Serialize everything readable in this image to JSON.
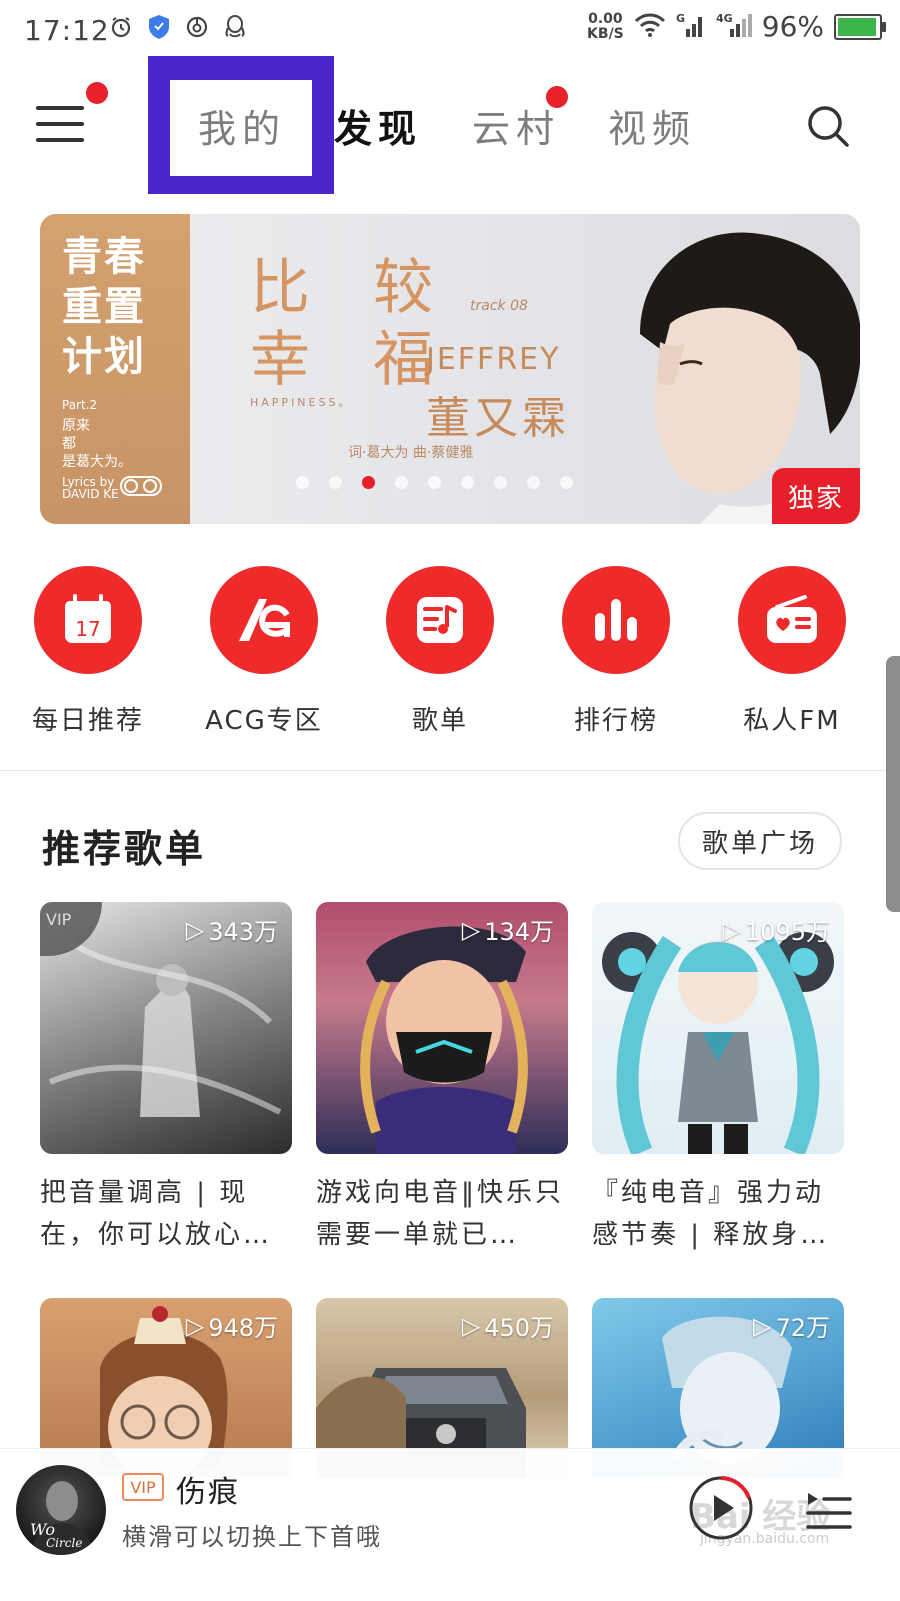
{
  "status_bar": {
    "time": "17:12",
    "net_speed_value": "0.00",
    "net_speed_unit": "KB/S",
    "battery": "96%",
    "battery_level": 0.96,
    "icons": [
      "alarm-icon",
      "shield-icon",
      "netease-icon",
      "qq-icon",
      "wifi-icon",
      "signal-g-icon",
      "signal-4g-icon"
    ]
  },
  "nav": {
    "tabs": [
      {
        "label": "我的",
        "active": false
      },
      {
        "label": "发现",
        "active": true
      },
      {
        "label": "云村",
        "active": false
      },
      {
        "label": "视频",
        "active": false
      }
    ],
    "highlight_color": "#4a25c9"
  },
  "banner": {
    "left_title": "青春重置计划",
    "left_part": "Part.2",
    "left_lines": [
      "原来",
      "都",
      "是葛大为。"
    ],
    "left_credit": "Lyrics by DAVID KE",
    "song_title_1": "比 较",
    "song_title_2": "幸 福",
    "track": "track 08",
    "happiness": "HAPPINESS。",
    "artist_en": "JEFFREY",
    "artist_cn": "董又霖",
    "credits": "词·葛大为   曲·蔡健雅",
    "badge": "独家",
    "dots_total": 9,
    "dots_active_index": 2
  },
  "quick_entries": [
    {
      "label": "每日推荐",
      "icon": "calendar-icon",
      "day": "17"
    },
    {
      "label": "ACG专区",
      "icon": "acg-icon"
    },
    {
      "label": "歌单",
      "icon": "playlist-icon"
    },
    {
      "label": "排行榜",
      "icon": "chart-icon"
    },
    {
      "label": "私人FM",
      "icon": "radio-icon"
    }
  ],
  "section": {
    "title": "推荐歌单",
    "button": "歌单广场"
  },
  "playlists": [
    {
      "title": "把音量调高 | 现在，你可以放心…",
      "plays": "343万",
      "vip": "VIP",
      "colors": [
        "#cfcfcf",
        "#3a3a3a"
      ]
    },
    {
      "title": "游戏向电音‖快乐只需要一单就已…",
      "plays": "134万",
      "colors": [
        "#c06a8a",
        "#2c2b4e"
      ]
    },
    {
      "title": "『纯电音』强力动感节奏 | 释放身…",
      "plays": "1095万",
      "colors": [
        "#e9f3f7",
        "#5fc7d6"
      ]
    },
    {
      "plays": "948万",
      "colors": [
        "#d49a68",
        "#8a5a3a"
      ]
    },
    {
      "plays": "450万",
      "colors": [
        "#d9c7aa",
        "#6c6c6c"
      ]
    },
    {
      "plays": "72万",
      "colors": [
        "#7fc9e8",
        "#2f79b4"
      ]
    }
  ],
  "player": {
    "vip": "VIP",
    "song": "伤痕",
    "hint": "横滑可以切换上下首哦",
    "watermark": "Bai 经验",
    "watermark_sub": "jingyan.baidu.com"
  },
  "accent": "#ef2a2a"
}
